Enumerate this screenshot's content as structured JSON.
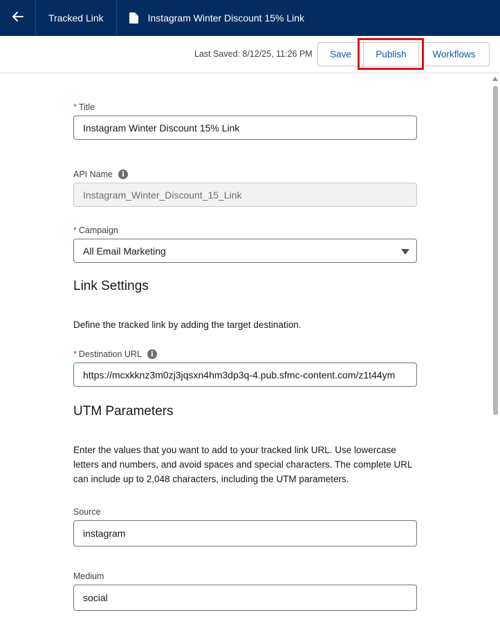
{
  "topbar": {
    "breadcrumb": "Tracked Link",
    "current_title": "Instagram Winter Discount 15% Link"
  },
  "toolbar": {
    "last_saved": "Last Saved: 8/12/25, 11:26 PM",
    "save_label": "Save",
    "publish_label": "Publish",
    "workflows_label": "Workflows"
  },
  "form": {
    "title": {
      "label": "Title",
      "required": "*",
      "value": "Instagram Winter Discount 15% Link"
    },
    "api_name": {
      "label": "API Name",
      "value": "Instagram_Winter_Discount_15_Link"
    },
    "campaign": {
      "label": "Campaign",
      "required": "*",
      "value": "All Email Marketing"
    },
    "link_settings": {
      "heading": "Link Settings",
      "description": "Define the tracked link by adding the target destination."
    },
    "destination_url": {
      "label": "Destination URL",
      "required": "*",
      "value": "https://mcxkknz3m0zj3jqsxn4hm3dp3q-4.pub.sfmc-content.com/z1t44ym"
    },
    "utm": {
      "heading": "UTM Parameters",
      "description": "Enter the values that you want to add to your tracked link URL. Use lowercase letters and numbers, and avoid spaces and special characters. The complete URL can include up to 2,048 characters, including the UTM parameters."
    },
    "source": {
      "label": "Source",
      "value": "instagram"
    },
    "medium": {
      "label": "Medium",
      "value": "social"
    }
  },
  "colors": {
    "topbar_bg": "#032d60",
    "link_blue": "#0b5cab",
    "highlight_red": "#e0101a",
    "required_red": "#c23934"
  },
  "icons": [
    "back-arrow-icon",
    "document-icon",
    "info-icon",
    "chevron-down-icon"
  ]
}
